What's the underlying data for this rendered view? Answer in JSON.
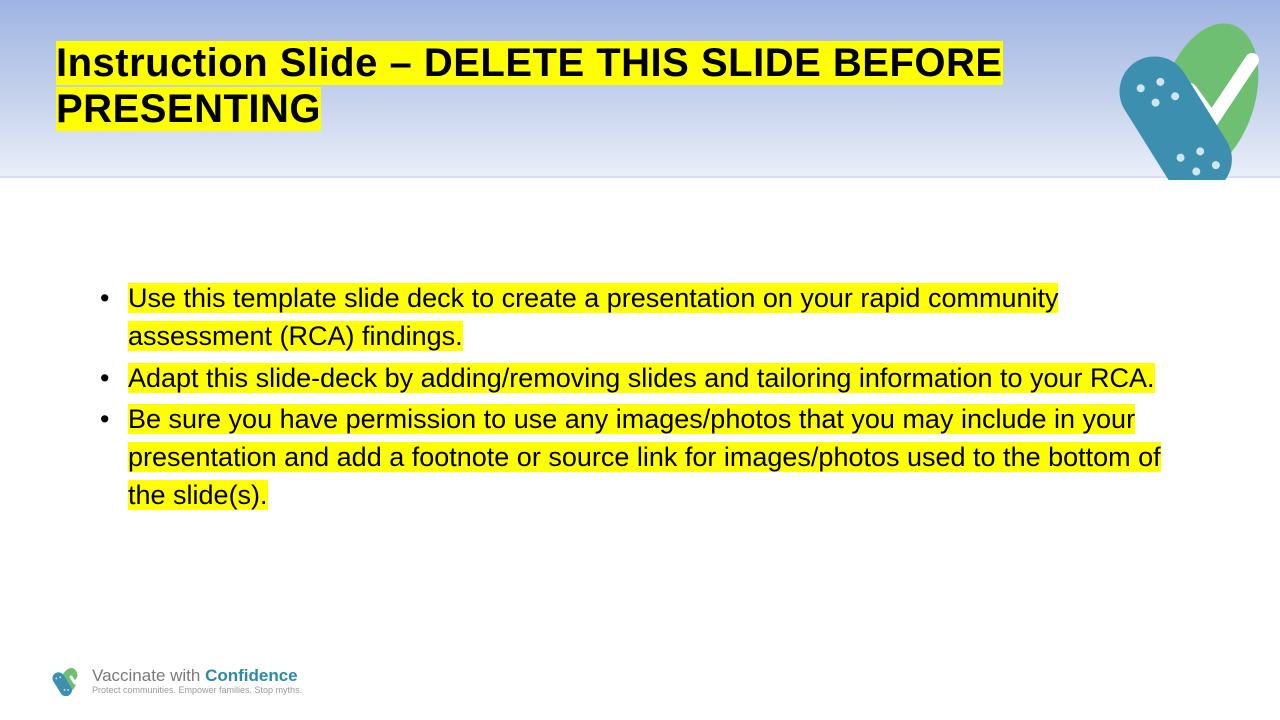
{
  "title": "Instruction Slide – DELETE THIS SLIDE BEFORE PRESENTING",
  "bullets": [
    "Use this template slide deck to create a presentation on your rapid community assessment (RCA) findings.",
    "Adapt this slide-deck by adding/removing slides and tailoring information to your RCA.",
    "Be sure you have permission to use any images/photos that you may include in your presentation and add a footnote or source link for images/photos used to the bottom of the slide(s)."
  ],
  "footer": {
    "line1a": "Vaccinate with ",
    "line1b": "Confidence",
    "line2": "Protect communities. Empower families. Stop myths."
  },
  "colors": {
    "highlight": "#ffff00",
    "bandage_blue": "#3d8fb0",
    "check_green": "#6fbf73"
  }
}
